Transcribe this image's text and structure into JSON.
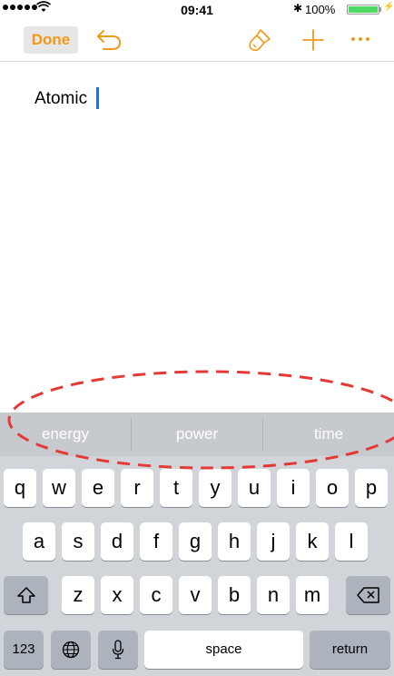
{
  "status_bar": {
    "time": "09:41",
    "battery_percent": "100%",
    "bluetooth": "✱",
    "charging": "⚡"
  },
  "toolbar": {
    "done_label": "Done"
  },
  "note": {
    "text": "Atomic"
  },
  "keyboard": {
    "suggestions": [
      "energy",
      "power",
      "time"
    ],
    "row1": [
      "q",
      "w",
      "e",
      "r",
      "t",
      "y",
      "u",
      "i",
      "o",
      "p"
    ],
    "row2": [
      "a",
      "s",
      "d",
      "f",
      "g",
      "h",
      "j",
      "k",
      "l"
    ],
    "row3": [
      "z",
      "x",
      "c",
      "v",
      "b",
      "n",
      "m"
    ],
    "numbers_label": "123",
    "space_label": "space",
    "return_label": "return"
  },
  "colors": {
    "accent": "#f19a17",
    "cursor": "#1a73e8",
    "annotation": "#e53935"
  }
}
